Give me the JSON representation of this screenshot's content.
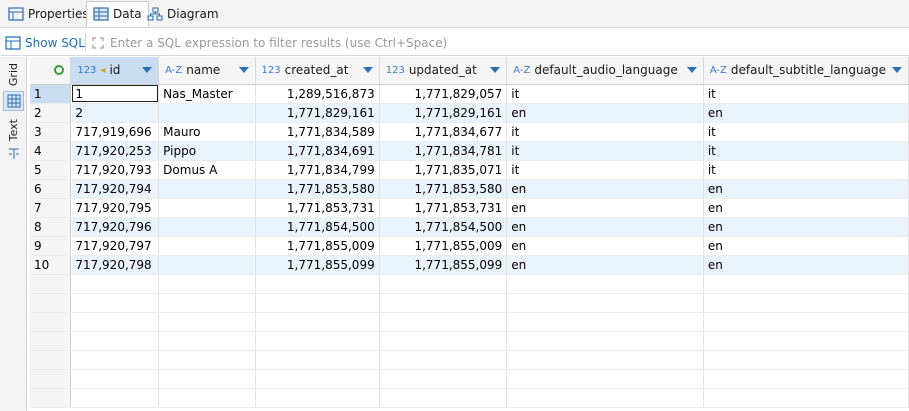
{
  "tabs": [
    {
      "label": "Properties",
      "icon": "properties-icon"
    },
    {
      "label": "Data",
      "icon": "grid-icon",
      "active": true
    },
    {
      "label": "Diagram",
      "icon": "diagram-icon"
    }
  ],
  "filter": {
    "show_sql_label": "Show SQL",
    "placeholder": "Enter a SQL expression to filter results (use Ctrl+Space)"
  },
  "side": {
    "grid_label": "Grid",
    "text_label": "Text"
  },
  "colors": {
    "accent": "#1c6fb8",
    "selected_header": "#c9dcf0",
    "alt_row": "#eaf2fb"
  },
  "columns": [
    {
      "type": "123",
      "name": "id"
    },
    {
      "type": "A-Z",
      "name": "name"
    },
    {
      "type": "123",
      "name": "created_at"
    },
    {
      "type": "123",
      "name": "updated_at"
    },
    {
      "type": "A-Z",
      "name": "default_audio_language"
    },
    {
      "type": "A-Z",
      "name": "default_subtitle_language"
    }
  ],
  "rows": [
    {
      "n": "1",
      "id": "1",
      "name": "Nas_Master",
      "created_at": "1,289,516,873",
      "updated_at": "1,771,829,057",
      "audio": "it",
      "subtitle": "it"
    },
    {
      "n": "2",
      "id": "2",
      "name": "",
      "created_at": "1,771,829,161",
      "updated_at": "1,771,829,161",
      "audio": "en",
      "subtitle": "en"
    },
    {
      "n": "3",
      "id": "717,919,696",
      "name": "Mauro",
      "created_at": "1,771,834,589",
      "updated_at": "1,771,834,677",
      "audio": "it",
      "subtitle": "it"
    },
    {
      "n": "4",
      "id": "717,920,253",
      "name": "Pippo",
      "created_at": "1,771,834,691",
      "updated_at": "1,771,834,781",
      "audio": "it",
      "subtitle": "it"
    },
    {
      "n": "5",
      "id": "717,920,793",
      "name": "Domus A",
      "created_at": "1,771,834,799",
      "updated_at": "1,771,835,071",
      "audio": "it",
      "subtitle": "it"
    },
    {
      "n": "6",
      "id": "717,920,794",
      "name": "",
      "created_at": "1,771,853,580",
      "updated_at": "1,771,853,580",
      "audio": "en",
      "subtitle": "en"
    },
    {
      "n": "7",
      "id": "717,920,795",
      "name": "",
      "created_at": "1,771,853,731",
      "updated_at": "1,771,853,731",
      "audio": "en",
      "subtitle": "en"
    },
    {
      "n": "8",
      "id": "717,920,796",
      "name": "",
      "created_at": "1,771,854,500",
      "updated_at": "1,771,854,500",
      "audio": "en",
      "subtitle": "en"
    },
    {
      "n": "9",
      "id": "717,920,797",
      "name": "",
      "created_at": "1,771,855,009",
      "updated_at": "1,771,855,009",
      "audio": "en",
      "subtitle": "en"
    },
    {
      "n": "10",
      "id": "717,920,798",
      "name": "",
      "created_at": "1,771,855,099",
      "updated_at": "1,771,855,099",
      "audio": "en",
      "subtitle": "en"
    }
  ]
}
